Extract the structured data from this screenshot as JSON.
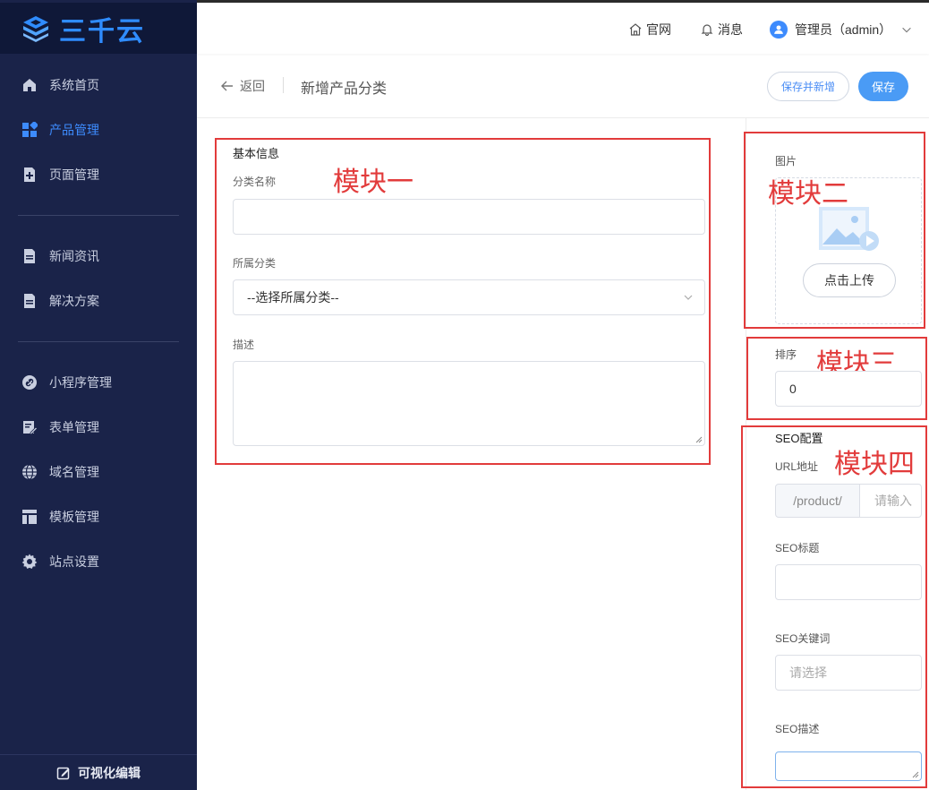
{
  "brand": {
    "name": "三千云",
    "accent": "#2f8cff"
  },
  "sidebar": {
    "items": [
      {
        "label": "系统首页",
        "icon": "home-icon",
        "active": false
      },
      {
        "label": "产品管理",
        "icon": "grid-icon",
        "active": true
      },
      {
        "label": "页面管理",
        "icon": "page-add-icon",
        "active": false
      },
      {
        "label": "新闻资讯",
        "icon": "document-icon",
        "active": false
      },
      {
        "label": "解决方案",
        "icon": "document-icon",
        "active": false
      },
      {
        "label": "小程序管理",
        "icon": "link-icon",
        "active": false
      },
      {
        "label": "表单管理",
        "icon": "form-edit-icon",
        "active": false
      },
      {
        "label": "域名管理",
        "icon": "globe-icon",
        "active": false
      },
      {
        "label": "模板管理",
        "icon": "layout-icon",
        "active": false
      },
      {
        "label": "站点设置",
        "icon": "gear-icon",
        "active": false
      }
    ],
    "visual_edit": "可视化编辑"
  },
  "header": {
    "website": "官网",
    "messages": "消息",
    "user": "管理员（admin）"
  },
  "pagebar": {
    "back": "返回",
    "title": "新增产品分类",
    "save_and_new": "保存并新增",
    "save": "保存"
  },
  "modules": {
    "one": "模块一",
    "two": "模块二",
    "three": "模块三",
    "four": "模块四"
  },
  "basic": {
    "section": "基本信息",
    "name_label": "分类名称",
    "name_value": "",
    "parent_label": "所属分类",
    "parent_value": "--选择所属分类--",
    "desc_label": "描述",
    "desc_value": ""
  },
  "image": {
    "label": "图片",
    "upload": "点击上传"
  },
  "sort": {
    "label": "排序",
    "value": "0"
  },
  "seo": {
    "section": "SEO配置",
    "url_label": "URL地址",
    "url_prefix": "/product/",
    "url_placeholder": "请输入",
    "title_label": "SEO标题",
    "title_value": "",
    "keywords_label": "SEO关键词",
    "keywords_placeholder": "请选择",
    "desc_label": "SEO描述",
    "desc_value": ""
  }
}
